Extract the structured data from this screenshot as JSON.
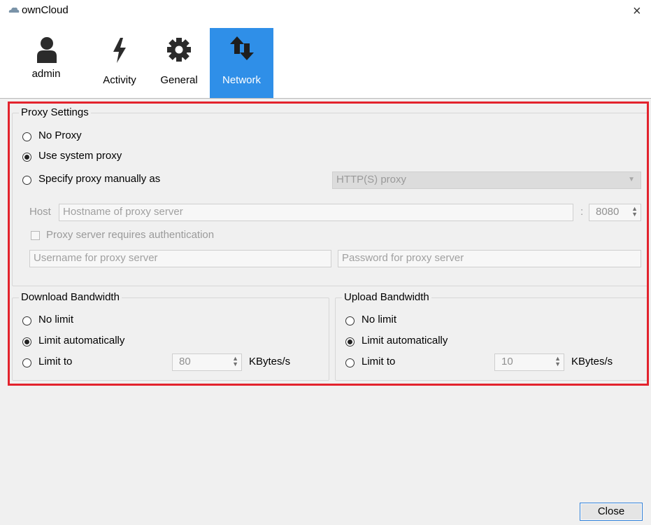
{
  "window": {
    "title": "ownCloud",
    "close_glyph": "×"
  },
  "toolbar": {
    "items": [
      {
        "label": "admin",
        "icon": "user-icon"
      },
      {
        "label": "Activity",
        "icon": "lightning-icon"
      },
      {
        "label": "General",
        "icon": "gear-icon"
      },
      {
        "label": "Network",
        "icon": "network-arrows-icon",
        "selected": true
      }
    ]
  },
  "proxy": {
    "title": "Proxy Settings",
    "options": [
      {
        "label": "No Proxy",
        "checked": false
      },
      {
        "label": "Use system proxy",
        "checked": true
      },
      {
        "label": "Specify proxy manually as",
        "checked": false
      }
    ],
    "type_select": "HTTP(S) proxy",
    "host_label": "Host",
    "host_placeholder": "Hostname of proxy server",
    "port_separator": ":",
    "port": "8080",
    "auth_label": "Proxy server requires authentication",
    "username_placeholder": "Username for proxy server",
    "password_placeholder": "Password for proxy server"
  },
  "download": {
    "title": "Download Bandwidth",
    "options": [
      {
        "label": "No limit",
        "checked": false
      },
      {
        "label": "Limit automatically",
        "checked": true
      },
      {
        "label": "Limit to",
        "checked": false
      }
    ],
    "limit_value": "80",
    "unit": "KBytes/s"
  },
  "upload": {
    "title": "Upload Bandwidth",
    "options": [
      {
        "label": "No limit",
        "checked": false
      },
      {
        "label": "Limit automatically",
        "checked": true
      },
      {
        "label": "Limit to",
        "checked": false
      }
    ],
    "limit_value": "10",
    "unit": "KBytes/s"
  },
  "footer": {
    "close_label": "Close"
  },
  "colors": {
    "accent": "#2f8fe8",
    "highlight_frame": "#e3232d",
    "background": "#f0f0f0"
  }
}
